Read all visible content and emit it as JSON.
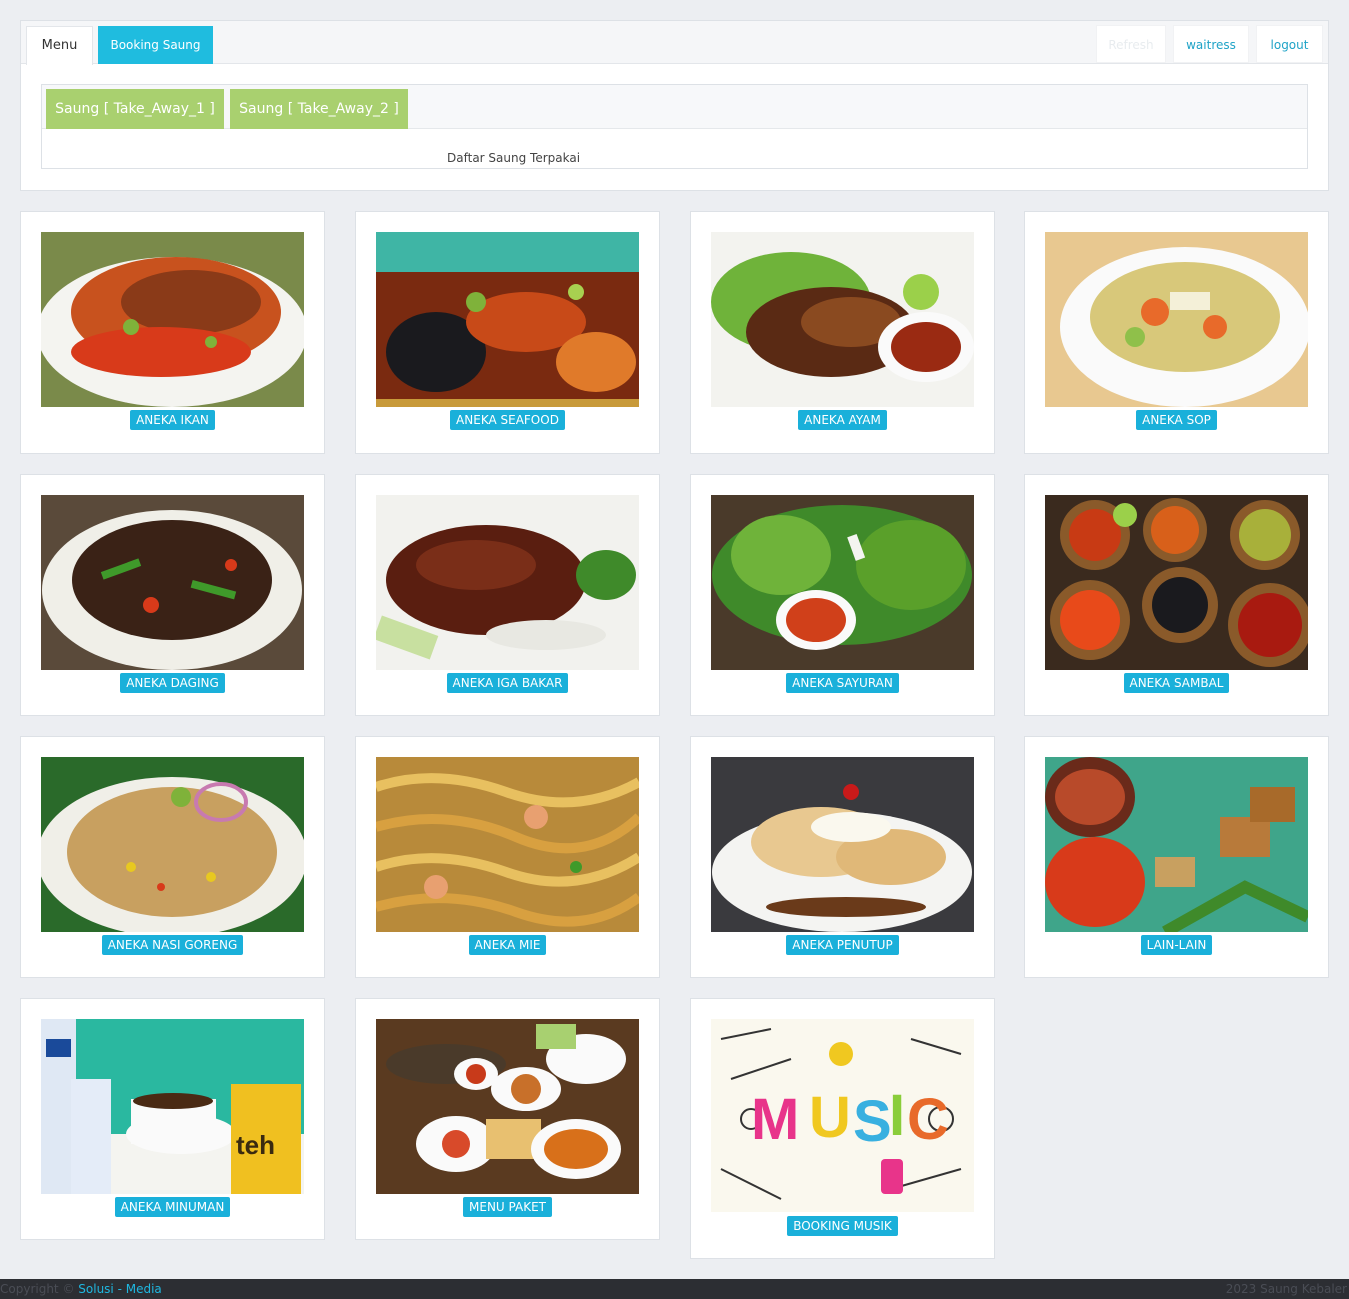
{
  "tabs": {
    "menu": "Menu",
    "booking": "Booking Saung",
    "blank": "Refresh",
    "waitress": "waitress",
    "logout": "logout"
  },
  "saung": {
    "btn1": "Saung [ Take_Away_1 ]",
    "btn2": "Saung [ Take_Away_2 ]",
    "caption": "Daftar Saung Terpakai"
  },
  "categories": [
    {
      "label": "ANEKA IKAN",
      "icon": "fried-fish-photo"
    },
    {
      "label": "ANEKA SEAFOOD",
      "icon": "seafood-photo"
    },
    {
      "label": "ANEKA AYAM",
      "icon": "grilled-chicken-photo"
    },
    {
      "label": "ANEKA SOP",
      "icon": "soup-photo"
    },
    {
      "label": "ANEKA DAGING",
      "icon": "beef-stirfry-photo"
    },
    {
      "label": "ANEKA IGA BAKAR",
      "icon": "grilled-ribs-photo"
    },
    {
      "label": "ANEKA SAYURAN",
      "icon": "vegetables-photo"
    },
    {
      "label": "ANEKA SAMBAL",
      "icon": "sambal-bowls-photo"
    },
    {
      "label": "ANEKA NASI GORENG",
      "icon": "fried-rice-photo"
    },
    {
      "label": "ANEKA MIE",
      "icon": "noodles-photo"
    },
    {
      "label": "ANEKA PENUTUP",
      "icon": "dessert-photo"
    },
    {
      "label": "LAIN-LAIN",
      "icon": "tofu-tempe-photo"
    },
    {
      "label": "ANEKA MINUMAN",
      "icon": "drinks-photo"
    },
    {
      "label": "MENU PAKET",
      "icon": "package-meal-photo"
    },
    {
      "label": "BOOKING MUSIK",
      "icon": "music-doodle-photo"
    }
  ],
  "footer": {
    "copyright": "Copyright ©",
    "brand": "Solusi - Media",
    "right": "2023 Saung Kebaler"
  }
}
